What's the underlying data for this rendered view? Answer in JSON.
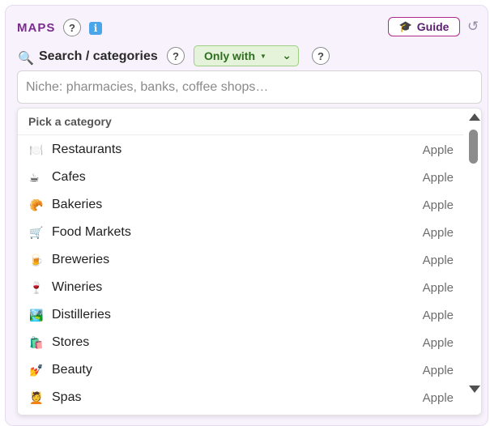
{
  "header": {
    "title": "MAPS",
    "help": "?",
    "info": "i",
    "guide_icon": "🎓",
    "guide_label": "Guide",
    "reset_icon": "↺"
  },
  "search": {
    "icon": "🔍",
    "label": "Search / categories",
    "help": "?",
    "filter_label": "Only with",
    "filter_help": "?",
    "placeholder": "Niche: pharmacies, banks, coffee shops…"
  },
  "dropdown": {
    "header": "Pick a category",
    "items": [
      {
        "emoji": "🍽️",
        "name": "Restaurants",
        "source": "Apple"
      },
      {
        "emoji": "☕",
        "name": "Cafes",
        "source": "Apple"
      },
      {
        "emoji": "🥐",
        "name": "Bakeries",
        "source": "Apple"
      },
      {
        "emoji": "🛒",
        "name": "Food Markets",
        "source": "Apple"
      },
      {
        "emoji": "🍺",
        "name": "Breweries",
        "source": "Apple"
      },
      {
        "emoji": "🍷",
        "name": "Wineries",
        "source": "Apple"
      },
      {
        "emoji": "🏞️",
        "name": "Distilleries",
        "source": "Apple"
      },
      {
        "emoji": "🛍️",
        "name": "Stores",
        "source": "Apple"
      },
      {
        "emoji": "💅",
        "name": "Beauty",
        "source": "Apple"
      },
      {
        "emoji": "💆",
        "name": "Spas",
        "source": "Apple"
      }
    ]
  }
}
